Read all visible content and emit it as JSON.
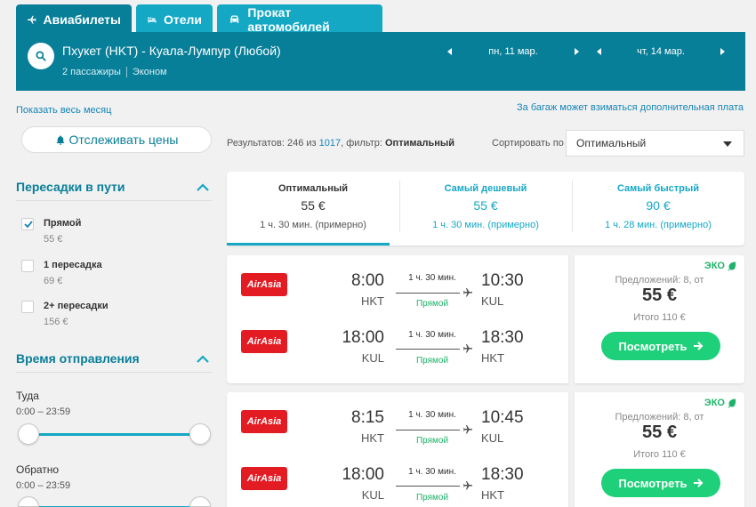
{
  "tabs": [
    {
      "label": "Авиабилеты",
      "icon": "plane-icon",
      "active": true
    },
    {
      "label": "Отели",
      "icon": "bed-icon",
      "active": false
    },
    {
      "label": "Прокат автомобилей",
      "icon": "car-icon",
      "active": false
    }
  ],
  "search": {
    "route": "Пхукет (HKT) - Куала-Лумпур (Любой)",
    "passengers": "2 пассажиры",
    "cabin": "Эконом",
    "date_out": "пн, 11 мар.",
    "date_back": "чт, 14 мар."
  },
  "links": {
    "show_month": "Показать весь месяц",
    "baggage_note": "За багаж может взиматься дополнительная плата"
  },
  "track_button": "Отслеживать цены",
  "filters": {
    "stops_title": "Пересадки в пути",
    "stops": [
      {
        "label": "Прямой",
        "price": "55 €",
        "checked": true
      },
      {
        "label": "1 пересадка",
        "price": "69 €",
        "checked": false
      },
      {
        "label": "2+ пересадки",
        "price": "156 €",
        "checked": false
      }
    ],
    "departure_title": "Время отправления",
    "outbound_label": "Туда",
    "outbound_range": "0:00 – 23:59",
    "return_label": "Обратно",
    "return_range": "0:00 – 23:59"
  },
  "results": {
    "prefix": "Результатов: 246 из ",
    "total": "1017",
    "middle": ", фильтр: ",
    "filter": "Оптимальный",
    "sort_label": "Сортировать по",
    "sort_value": "Оптимальный"
  },
  "summary": [
    {
      "title": "Оптимальный",
      "price": "55 €",
      "duration": "1 ч. 30 мин. (примерно)",
      "active": true
    },
    {
      "title": "Самый дешевый",
      "price": "55 €",
      "duration": "1 ч. 30 мин. (примерно)",
      "active": false
    },
    {
      "title": "Самый быстрый",
      "price": "90 €",
      "duration": "1 ч. 28 мин. (примерно)",
      "active": false
    }
  ],
  "flights": [
    {
      "legs": [
        {
          "airline": "AirAsia",
          "dep_time": "8:00",
          "dep_code": "HKT",
          "arr_time": "10:30",
          "arr_code": "KUL",
          "duration": "1 ч. 30 мин.",
          "stops": "Прямой"
        },
        {
          "airline": "AirAsia",
          "dep_time": "18:00",
          "dep_code": "KUL",
          "arr_time": "18:30",
          "arr_code": "HKT",
          "duration": "1 ч. 30 мин.",
          "stops": "Прямой"
        }
      ],
      "eco": "ЭКО",
      "offers": "Предложений: 8, от",
      "price": "55 €",
      "total": "Итого 110 €",
      "button": "Посмотреть"
    },
    {
      "legs": [
        {
          "airline": "AirAsia",
          "dep_time": "8:15",
          "dep_code": "HKT",
          "arr_time": "10:45",
          "arr_code": "KUL",
          "duration": "1 ч. 30 мин.",
          "stops": "Прямой"
        },
        {
          "airline": "AirAsia",
          "dep_time": "18:00",
          "dep_code": "KUL",
          "arr_time": "18:30",
          "arr_code": "HKT",
          "duration": "1 ч. 30 мин.",
          "stops": "Прямой"
        }
      ],
      "eco": "ЭКО",
      "offers": "Предложений: 8, от",
      "price": "55 €",
      "total": "Итого 110 €",
      "button": "Посмотреть"
    }
  ],
  "colors": {
    "header": "#087f99",
    "tab_inactive": "#14a8c5",
    "accent": "#14a8c5",
    "green": "#1fd07a",
    "airline_red": "#e31b23"
  }
}
